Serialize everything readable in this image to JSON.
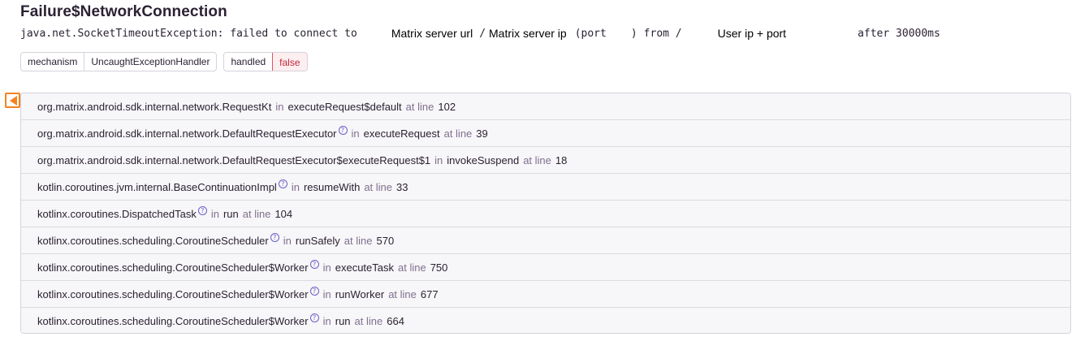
{
  "exception": {
    "title": "Failure$NetworkConnection",
    "message_parts": {
      "p1": "java.net.SocketTimeoutException: failed to connect to",
      "r1": "Matrix server url",
      "sep1": "/",
      "r2": "Matrix server ip",
      "p2": "(port",
      "p3": ")",
      "p4": "from /",
      "r3": "User ip + port",
      "p5": "after 30000ms"
    }
  },
  "tags": [
    {
      "key": "mechanism",
      "value": "UncaughtExceptionHandler"
    },
    {
      "key": "handled",
      "value": "false"
    }
  ],
  "colors": {
    "accent_marker": "#f5821f",
    "handled_false": "#e05565"
  },
  "frames": [
    {
      "module": "org.matrix.android.sdk.internal.network.RequestKt",
      "in_label": "in",
      "function": "executeRequest$default",
      "at_label": "at line",
      "line": "102",
      "help": false
    },
    {
      "module": "org.matrix.android.sdk.internal.network.DefaultRequestExecutor",
      "in_label": "in",
      "function": "executeRequest",
      "at_label": "at line",
      "line": "39",
      "help": true
    },
    {
      "module": "org.matrix.android.sdk.internal.network.DefaultRequestExecutor$executeRequest$1",
      "in_label": "in",
      "function": "invokeSuspend",
      "at_label": "at line",
      "line": "18",
      "help": false
    },
    {
      "module": "kotlin.coroutines.jvm.internal.BaseContinuationImpl",
      "in_label": "in",
      "function": "resumeWith",
      "at_label": "at line",
      "line": "33",
      "help": true
    },
    {
      "module": "kotlinx.coroutines.DispatchedTask",
      "in_label": "in",
      "function": "run",
      "at_label": "at line",
      "line": "104",
      "help": true
    },
    {
      "module": "kotlinx.coroutines.scheduling.CoroutineScheduler",
      "in_label": "in",
      "function": "runSafely",
      "at_label": "at line",
      "line": "570",
      "help": true
    },
    {
      "module": "kotlinx.coroutines.scheduling.CoroutineScheduler$Worker",
      "in_label": "in",
      "function": "executeTask",
      "at_label": "at line",
      "line": "750",
      "help": true
    },
    {
      "module": "kotlinx.coroutines.scheduling.CoroutineScheduler$Worker",
      "in_label": "in",
      "function": "runWorker",
      "at_label": "at line",
      "line": "677",
      "help": true
    },
    {
      "module": "kotlinx.coroutines.scheduling.CoroutineScheduler$Worker",
      "in_label": "in",
      "function": "run",
      "at_label": "at line",
      "line": "664",
      "help": true
    }
  ]
}
